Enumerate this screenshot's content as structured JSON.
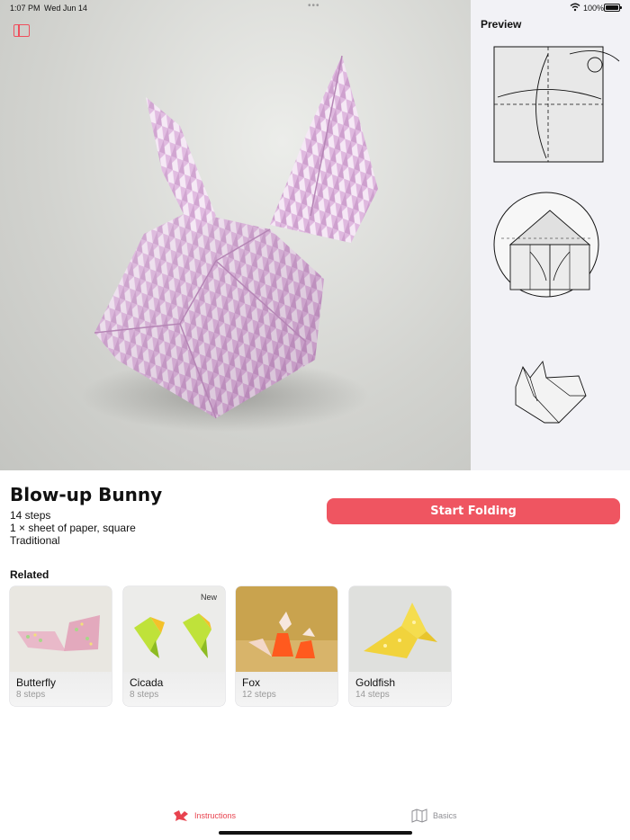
{
  "status_bar": {
    "time": "1:07 PM",
    "date": "Wed Jun 14",
    "battery": "100%"
  },
  "preview": {
    "title": "Preview"
  },
  "model": {
    "title": "Blow-up Bunny",
    "steps": "14 steps",
    "paper": "1 × sheet of paper, square",
    "origin": "Traditional",
    "start_label": "Start Folding"
  },
  "related": {
    "title": "Related",
    "items": [
      {
        "name": "Butterfly",
        "steps": "8 steps",
        "badge": ""
      },
      {
        "name": "Cicada",
        "steps": "8 steps",
        "badge": "New"
      },
      {
        "name": "Fox",
        "steps": "12 steps",
        "badge": ""
      },
      {
        "name": "Goldfish",
        "steps": "14 steps",
        "badge": ""
      }
    ]
  },
  "tabs": [
    {
      "label": "Instructions",
      "icon": "origami-icon",
      "active": true
    },
    {
      "label": "Basics",
      "icon": "map-book-icon",
      "active": false
    }
  ],
  "colors": {
    "accent": "#ef5561",
    "active_tab": "#e8434f",
    "inactive_tab": "#8e8e93",
    "paper_pink": "#dcb0dc"
  }
}
